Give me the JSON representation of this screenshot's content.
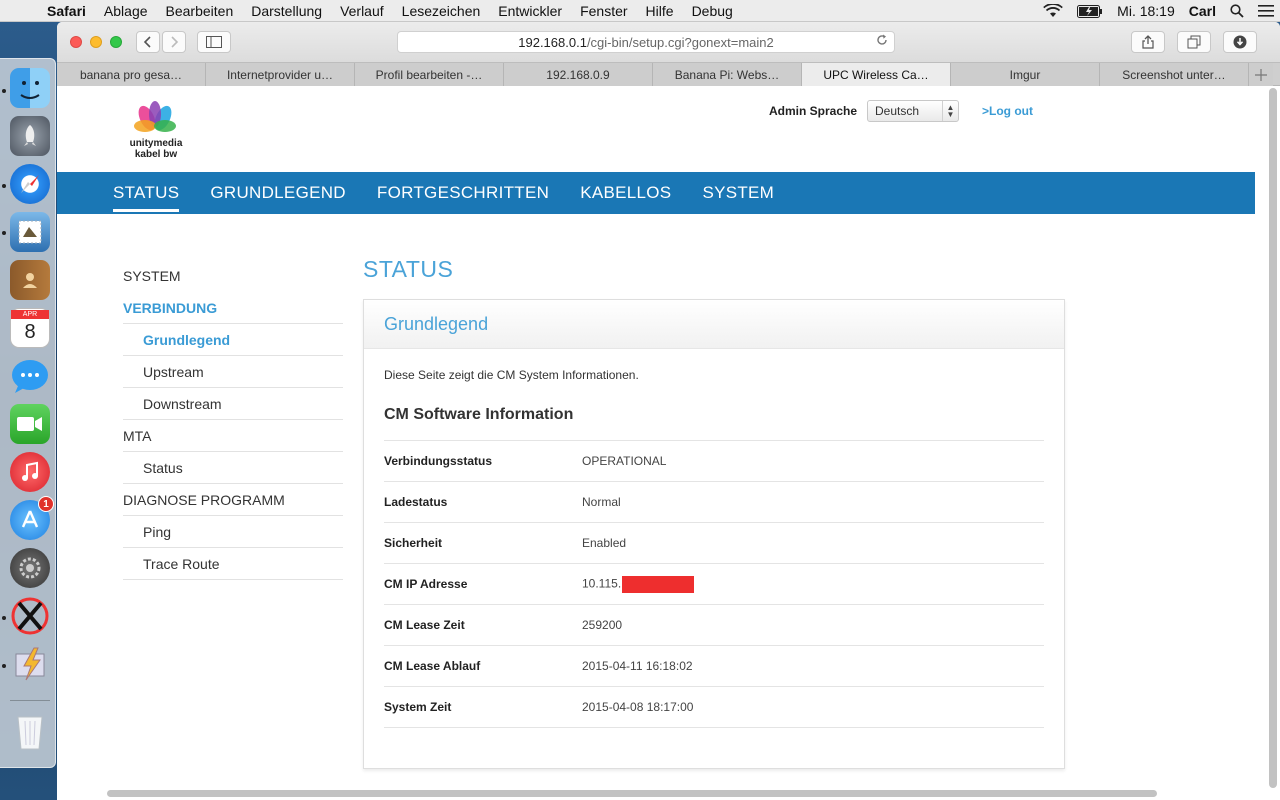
{
  "menubar": {
    "app": "Safari",
    "items": [
      "Ablage",
      "Bearbeiten",
      "Darstellung",
      "Verlauf",
      "Lesezeichen",
      "Entwickler",
      "Fenster",
      "Hilfe",
      "Debug"
    ],
    "clock": "Mi. 18:19",
    "user": "Carl"
  },
  "browser": {
    "url_host": "192.168.0.1",
    "url_path": "/cgi-bin/setup.cgi?gonext=main2",
    "tabs": [
      "banana pro gesa…",
      "Internetprovider u…",
      "Profil bearbeiten -…",
      "192.168.0.9",
      "Banana Pi: Webs…",
      "UPC Wireless Ca…",
      "Imgur",
      "Screenshot unter…"
    ],
    "active_tab": 5
  },
  "dock": {
    "calendar_month": "APR",
    "calendar_day": "8",
    "appstore_badge": "1"
  },
  "page": {
    "logo_line1": "unitymedia",
    "logo_line2": "kabel bw",
    "admin_label": "Admin Sprache",
    "language": "Deutsch",
    "logout": ">Log out",
    "nav": [
      "STATUS",
      "GRUNDLEGEND",
      "FORTGESCHRITTEN",
      "KABELLOS",
      "SYSTEM"
    ],
    "sidebar": [
      {
        "label": "SYSTEM",
        "level": 1
      },
      {
        "label": "VERBINDUNG",
        "level": 1
      },
      {
        "label": "Grundlegend",
        "level": 2
      },
      {
        "label": "Upstream",
        "level": 2
      },
      {
        "label": "Downstream",
        "level": 2
      },
      {
        "label": "MTA",
        "level": 1
      },
      {
        "label": "Status",
        "level": 2
      },
      {
        "label": "DIAGNOSE PROGRAMM",
        "level": 1
      },
      {
        "label": "Ping",
        "level": 2
      },
      {
        "label": "Trace Route",
        "level": 2
      }
    ],
    "title": "STATUS",
    "panel_title": "Grundlegend",
    "description": "Diese Seite zeigt die CM System Informationen.",
    "section_title": "CM Software Information",
    "rows": [
      {
        "key": "Verbindungsstatus",
        "value": "OPERATIONAL"
      },
      {
        "key": "Ladestatus",
        "value": "Normal"
      },
      {
        "key": "Sicherheit",
        "value": "Enabled"
      },
      {
        "key": "CM IP Adresse",
        "value": "10.115."
      },
      {
        "key": "CM Lease Zeit",
        "value": "259200"
      },
      {
        "key": "CM Lease Ablauf",
        "value": "2015-04-11 16:18:02"
      },
      {
        "key": "System Zeit",
        "value": "2015-04-08 18:17:00"
      }
    ]
  },
  "colors": {
    "nav_blue": "#1a77b5",
    "accent_blue": "#3a9bd5",
    "redaction": "#ee2e2e"
  }
}
